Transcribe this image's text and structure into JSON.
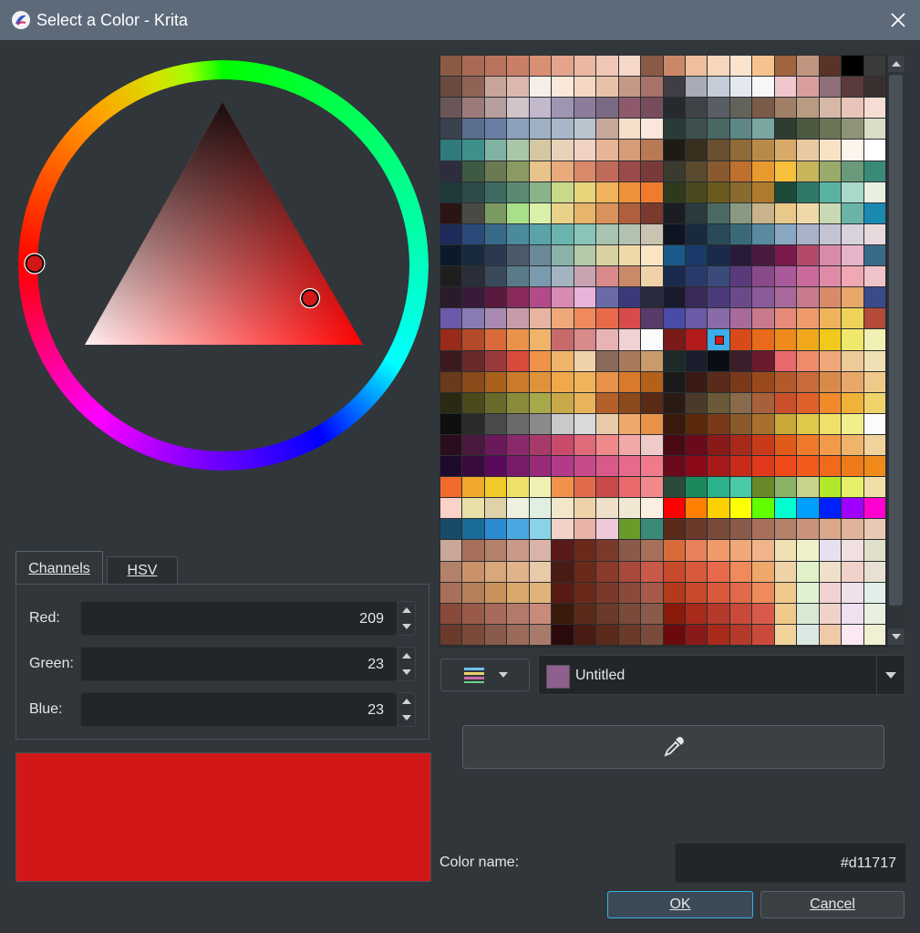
{
  "window": {
    "title": "Select a Color - Krita"
  },
  "wheel": {
    "hue_handle_color": "#d11717",
    "triangle_tip_color": "#ff0000"
  },
  "tabs": [
    {
      "label": "Channels",
      "active": true
    },
    {
      "label": "HSV",
      "active": false
    }
  ],
  "channels": [
    {
      "label": "Red:",
      "value": "209"
    },
    {
      "label": "Green:",
      "value": "23"
    },
    {
      "label": "Blue:",
      "value": "23"
    }
  ],
  "preview": {
    "color": "#d11717"
  },
  "palette": {
    "name": "Untitled",
    "chip_color": "#8f5f8e",
    "selected_color": "#d11717",
    "swatches": [
      [
        "#8a5a44",
        "#a86a52",
        "#b9735d",
        "#c97f66",
        "#d98f74",
        "#e3a38c",
        "#ebb7a3",
        "#f0c7b7",
        "#f5d8ca",
        "#8a5a44",
        "#c98868",
        "#f0be9a",
        "#f6d6bd",
        "#fbe4cd",
        "#f6c38f",
        "#a0643e",
        "#c0947e",
        "#5a3228",
        "#000000",
        "#3a3a3a"
      ],
      [
        "#6a4a40",
        "#8f6457",
        "#c8a49a",
        "#dbb7b0",
        "#f6efe9",
        "#fbe8d9",
        "#f5d8c3",
        "#e8c2a7",
        "#c49a87",
        "#a87268",
        "#3e3e44",
        "#a7acb6",
        "#c5cbd7",
        "#e6e8ef",
        "#f7f7f7",
        "#f1c7cf",
        "#d99e9e",
        "#8f7078",
        "#5a3a3a",
        "#3a2f2f"
      ],
      [
        "#6a5658",
        "#9c7a78",
        "#b79e9f",
        "#d1c4c8",
        "#c4b9cc",
        "#9f95b3",
        "#8c7b9b",
        "#7a6a83",
        "#8e5a6b",
        "#774d5d",
        "#262a2e",
        "#3f4348",
        "#585e63",
        "#636359",
        "#7a5a48",
        "#9f8066",
        "#b79c82",
        "#d6b8a6",
        "#e8c5b8",
        "#f5ddd4"
      ],
      [
        "#3a4250",
        "#5a6e8f",
        "#6a7fa3",
        "#8ca0bd",
        "#9fb0c4",
        "#a8b7c8",
        "#b9c5ce",
        "#c8a89a",
        "#f6dfc9",
        "#fce6d9",
        "#2a3a38",
        "#3d504d",
        "#4a6864",
        "#5f8785",
        "#7aa6a1",
        "#2f3c32",
        "#4d5a42",
        "#6b7556",
        "#8e9477",
        "#d9ddc8"
      ],
      [
        "#2f7a7a",
        "#3f8f8a",
        "#7fb3a4",
        "#a8c6a8",
        "#d4c7a2",
        "#e8d3b8",
        "#f0d2c2",
        "#e8b497",
        "#d69c78",
        "#b87954",
        "#1e1b14",
        "#3a2e1e",
        "#6a5030",
        "#8f6b3a",
        "#b78a4a",
        "#d7aa6a",
        "#eac9a0",
        "#f6e3c6",
        "#fbf5ec",
        "#ffffff"
      ],
      [
        "#2e2d3e",
        "#3e5a42",
        "#6a7a52",
        "#8a9a62",
        "#e8c38a",
        "#e8aa7a",
        "#d9886a",
        "#c06a5a",
        "#9a4a4a",
        "#7a3a3a",
        "#3a3a2e",
        "#5a4a2e",
        "#8a5a2e",
        "#c0702e",
        "#e89a2e",
        "#f6c03a",
        "#c9b45a",
        "#9aaa6a",
        "#6a9a7a",
        "#3a8a7a"
      ],
      [
        "#1e3a3a",
        "#2e4a4a",
        "#3e6a62",
        "#5a8a72",
        "#8ab38a",
        "#c9d98a",
        "#e8d27a",
        "#f0b25a",
        "#f0923a",
        "#f07a2e",
        "#2e3a1e",
        "#4a4a1e",
        "#6a5a1e",
        "#8a6a2e",
        "#b07a2e",
        "#1e4a3a",
        "#2e7a6a",
        "#5ab3a2",
        "#a8d9c9",
        "#e8f0e0"
      ],
      [
        "#2a1414",
        "#4a4a44",
        "#7a9a62",
        "#a8e08a",
        "#d9f0a8",
        "#e8d28a",
        "#e8b36a",
        "#d9925a",
        "#b0603e",
        "#7a3a2e",
        "#1a1e22",
        "#2a3a3e",
        "#4a6a62",
        "#8a9a82",
        "#c9b38a",
        "#e8c98a",
        "#f0d9a8",
        "#c9d9b3",
        "#6ab3a8",
        "#1a8ab3"
      ],
      [
        "#1e2a5a",
        "#2a4a7a",
        "#3a6a8a",
        "#4a8a9a",
        "#5aa3a8",
        "#6ab3ae",
        "#8ac3b7",
        "#a8c3b0",
        "#b3c3b0",
        "#c9c3b0",
        "#0e1420",
        "#1a2a3e",
        "#2a4a5a",
        "#3a6a7a",
        "#5a8aa0",
        "#8aa8c3",
        "#a8b3c9",
        "#c3c3d2",
        "#d9d2dc",
        "#e8d9dc"
      ],
      [
        "#0a1a2a",
        "#1a2a3e",
        "#2a3a4e",
        "#4a5a6a",
        "#6a8a9a",
        "#8ab3a8",
        "#b3c9a8",
        "#d9d2a0",
        "#f0d9a8",
        "#fbe4c4",
        "#1a5a8a",
        "#1a3a6a",
        "#1a2a4a",
        "#2a1a3a",
        "#4a1a3e",
        "#7a1a4a",
        "#b34a6a",
        "#d98aa8",
        "#e8b3c9",
        "#3a6a8a"
      ],
      [
        "#1e1e1e",
        "#2a2e3a",
        "#3a4a5a",
        "#5a7a8a",
        "#7a9ab0",
        "#a3b3c0",
        "#c9a3b0",
        "#d98a8a",
        "#c98a6a",
        "#f0d2a8",
        "#1a2a4e",
        "#2a3a6a",
        "#3a4a7a",
        "#5a3a7a",
        "#8a4a8a",
        "#a85a9a",
        "#c96a9a",
        "#e08aa8",
        "#f0a8b3",
        "#f0c3c9"
      ],
      [
        "#2a1a2a",
        "#3a1a3a",
        "#5a1a3e",
        "#8a2a5a",
        "#b34a8a",
        "#d98ab3",
        "#e8b3d9",
        "#6a6aa8",
        "#3a3a7a",
        "#2a2a3e",
        "#1a1a2e",
        "#3a2a5a",
        "#4a3a7a",
        "#6a4a8a",
        "#8a5a9a",
        "#a86a9a",
        "#c97a8a",
        "#d98a6a",
        "#e8a86a",
        "#3a4a8a"
      ],
      [
        "#6a5aa8",
        "#8a7ab3",
        "#a88ab3",
        "#c99aa8",
        "#e8b3a0",
        "#f0a87a",
        "#f08a5a",
        "#e86a4a",
        "#d94a4a",
        "#5a3a6a",
        "#4a4aa8",
        "#6a5aa8",
        "#8a6aa8",
        "#a86a9a",
        "#c97a8a",
        "#e88a7a",
        "#f09a6a",
        "#f0b35a",
        "#f0d25a",
        "#b34a3a"
      ],
      [
        "#9a2a1a",
        "#b34a2a",
        "#d96a3a",
        "#e8924a",
        "#f0b36a",
        "#c96a6a",
        "#d98a8a",
        "#e8b3b3",
        "#f0d2d2",
        "#fbfbfb",
        "#7a1a1a",
        "#b31a1a",
        "#d11717",
        "#d94a1a",
        "#e86a1a",
        "#f08a1a",
        "#f0a81a",
        "#f0c91a",
        "#f0e86a",
        "#f0f0b3"
      ],
      [
        "#3a1a1e",
        "#6a2a2a",
        "#9a3a3a",
        "#d94a3a",
        "#f0924a",
        "#f0b36a",
        "#f0d2a8",
        "#8a6a5a",
        "#a87a5a",
        "#c99a6a",
        "#1e2a2a",
        "#1a1e2e",
        "#0a0e14",
        "#3a1e2a",
        "#6a1a2a",
        "#e86a6a",
        "#f08a6a",
        "#f0a87a",
        "#f0c99a",
        "#f0e0b3"
      ],
      [
        "#6a3a1a",
        "#8a4a1a",
        "#a8601a",
        "#c97a2a",
        "#e0923a",
        "#f0a84a",
        "#f0b35a",
        "#e8924a",
        "#d97a2a",
        "#b3601a",
        "#1a1a1a",
        "#3a1a14",
        "#5a2a1a",
        "#7a3a1a",
        "#9a4a1a",
        "#b35a2a",
        "#c96a3a",
        "#d98a4a",
        "#e8a86a",
        "#f0c98a"
      ],
      [
        "#2a2a14",
        "#4a4a1a",
        "#6a6a2a",
        "#8a8a3a",
        "#a8a84a",
        "#c9a84a",
        "#e8b35a",
        "#b3602a",
        "#8a4a1a",
        "#5a2a14",
        "#2a1a14",
        "#4a3a2a",
        "#6a5a3a",
        "#8a6a4a",
        "#a8603a",
        "#c9502a",
        "#e0602a",
        "#f08a2a",
        "#f0b33a",
        "#f0d26a"
      ],
      [
        "#0e0e0e",
        "#2a2a2a",
        "#4a4a4a",
        "#6a6a6a",
        "#8a8a8a",
        "#c9c9c9",
        "#d9d9d9",
        "#e8c9a8",
        "#f0a86a",
        "#e8924a",
        "#3a1a0a",
        "#5a2a0a",
        "#7a3a1a",
        "#8a5a2a",
        "#a8702a",
        "#c9a83a",
        "#e0c94a",
        "#f0e06a",
        "#f0f08a",
        "#fbfbfb"
      ],
      [
        "#2a0e1e",
        "#4a1a3e",
        "#6a1a5a",
        "#8a2a6a",
        "#a83a6a",
        "#c94a6a",
        "#e06a7a",
        "#f08a8a",
        "#f0a8a8",
        "#f0c9c9",
        "#4a0a14",
        "#6a0a1a",
        "#8a1a1a",
        "#a82a1a",
        "#c93a1a",
        "#e05a1a",
        "#f07a2a",
        "#f09a4a",
        "#f0b36a",
        "#f0d29a"
      ],
      [
        "#1e0a2a",
        "#3a0a3e",
        "#5a0a5a",
        "#7a1a6a",
        "#9a2a7a",
        "#b33a8a",
        "#c94a8a",
        "#d95a8a",
        "#e86a8a",
        "#f07a8a",
        "#6a0a1a",
        "#8a0a1a",
        "#a81a1a",
        "#c92a1a",
        "#e03a1a",
        "#f04a1a",
        "#f05a1a",
        "#f06a1a",
        "#f07a1a",
        "#f08a1a"
      ],
      [
        "#f06a2a",
        "#f0a82a",
        "#f0c92a",
        "#f0e06a",
        "#f0f0b3",
        "#f0924a",
        "#e06a4a",
        "#c94a4a",
        "#e86a6a",
        "#f08a8a",
        "#2a4a3a",
        "#1a8a5a",
        "#2ab38a",
        "#4ac9a8",
        "#6a8a2a",
        "#8ab36a",
        "#c9d28a",
        "#b3e82a",
        "#e8f06a",
        "#f0e0a8"
      ],
      [
        "#fbd2c9",
        "#e8e0a8",
        "#e0d2a8",
        "#f0f0e0",
        "#e0f0e0",
        "#f0e8c9",
        "#f0d2a8",
        "#f0e0c9",
        "#f0e8d2",
        "#fbf0e0",
        "#ff0000",
        "#ff8000",
        "#ffd000",
        "#ffff00",
        "#60ff00",
        "#00ffd0",
        "#00a0ff",
        "#0020ff",
        "#a000ff",
        "#ff00d0"
      ],
      [
        "#1a4a6a",
        "#1a6a9a",
        "#2a8ad2",
        "#4aa8e0",
        "#8ad2e8",
        "#f0d2c9",
        "#e8b3a8",
        "#f0c9d9",
        "#6a9a2a",
        "#3a8a7a",
        "#5a2a1a",
        "#6a3a2a",
        "#7a4a3a",
        "#8a5a4a",
        "#a8705a",
        "#b3806a",
        "#c9927a",
        "#d9a88a",
        "#e0b39a",
        "#e8c9b3"
      ],
      [
        "#c9a89a",
        "#a8705a",
        "#b3806a",
        "#c99a8a",
        "#d9b3a8",
        "#5a1a1a",
        "#6a2a1a",
        "#7a3a2a",
        "#8a5a4a",
        "#a8705a",
        "#d96a3a",
        "#e8805a",
        "#f09a6a",
        "#f0a87a",
        "#f0b38a",
        "#f0e0b3",
        "#f0f0c9",
        "#e8e0f0",
        "#f0e0e0",
        "#e0e0c9"
      ],
      [
        "#b3806a",
        "#c9926a",
        "#d9a87a",
        "#e0b38a",
        "#e8c9a8",
        "#4a1a14",
        "#6a2a1a",
        "#8a3a2a",
        "#a84a3a",
        "#c95a4a",
        "#c94a2a",
        "#d95a3a",
        "#e86a4a",
        "#f08a5a",
        "#f0a86a",
        "#f0d2a8",
        "#e0f0c9",
        "#f0e0c9",
        "#f0d2c9",
        "#e8e0d2"
      ],
      [
        "#a8705a",
        "#b3805a",
        "#c9925a",
        "#d9a86a",
        "#e0b37a",
        "#5a1a14",
        "#6a2a1a",
        "#7a3a2a",
        "#8a4a3a",
        "#a85a4a",
        "#b33a1a",
        "#c94a2a",
        "#d95a3a",
        "#e06a4a",
        "#f08a5a",
        "#f0c98a",
        "#e0f0d2",
        "#f0d2d2",
        "#f0e0e8",
        "#e0f0e8"
      ],
      [
        "#8a4a3a",
        "#9a5a4a",
        "#a86a5a",
        "#b37a6a",
        "#c98a7a",
        "#3a1a0a",
        "#5a2a1a",
        "#6a3a2a",
        "#7a4a3a",
        "#8a5a4a",
        "#8a1a0a",
        "#a82a1a",
        "#b33a2a",
        "#c94a3a",
        "#d95a4a",
        "#f0c98a",
        "#d9e8d2",
        "#f0d2c9",
        "#f0e0f0",
        "#e8f0e0"
      ],
      [
        "#6a3a2a",
        "#7a4a3a",
        "#8a5a4a",
        "#9a6a5a",
        "#a87a6a",
        "#2a0a0a",
        "#4a1a14",
        "#5a2a1a",
        "#6a3a2a",
        "#7a4a3a",
        "#6a0a0a",
        "#8a1a1a",
        "#a82a1a",
        "#b33a2a",
        "#c94a3a",
        "#f0d29a",
        "#d9e8e0",
        "#f0c9a8",
        "#fbe8f0",
        "#f0f0d2"
      ]
    ]
  },
  "palette_type_icon": "palette-icon",
  "picker_icon": "eyedropper-icon",
  "color_name": {
    "label": "Color name:",
    "value": "#d11717"
  },
  "buttons": {
    "ok": "OK",
    "cancel": "Cancel"
  }
}
